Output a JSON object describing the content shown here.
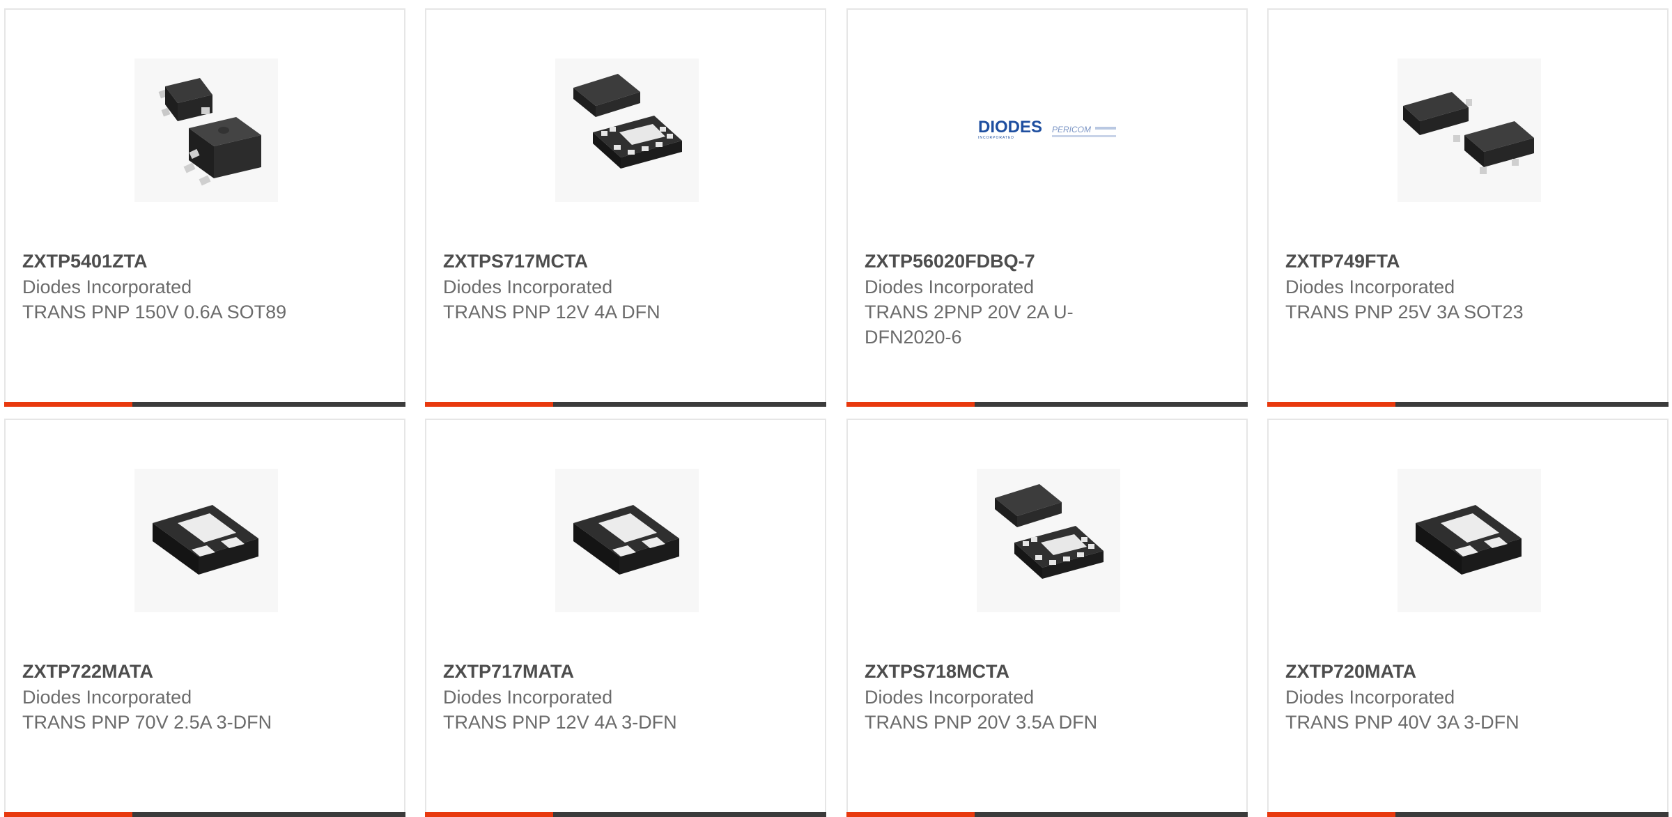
{
  "products": [
    {
      "part": "ZXTP5401ZTA",
      "manufacturer": "Diodes Incorporated",
      "description": "TRANS PNP 150V 0.6A SOT89",
      "image": "sot89-package-icon"
    },
    {
      "part": "ZXTPS717MCTA",
      "manufacturer": "Diodes Incorporated",
      "description": "TRANS PNP 12V 4A DFN",
      "image": "dfn8-package-icon"
    },
    {
      "part": "ZXTP56020FDBQ-7",
      "manufacturer": "Diodes Incorporated",
      "description": "TRANS 2PNP 20V 2A U-DFN2020-6",
      "image": "diodes-pericom-logo",
      "logo_text": "DIODES",
      "logo_sub": "INCORPORATED",
      "logo_text2": "PERICOM"
    },
    {
      "part": "ZXTP749FTA",
      "manufacturer": "Diodes Incorporated",
      "description": "TRANS PNP 25V 3A SOT23",
      "image": "sot23-package-icon"
    },
    {
      "part": "ZXTP722MATA",
      "manufacturer": "Diodes Incorporated",
      "description": "TRANS PNP 70V 2.5A 3-DFN",
      "image": "dfn3-package-icon"
    },
    {
      "part": "ZXTP717MATA",
      "manufacturer": "Diodes Incorporated",
      "description": "TRANS PNP 12V 4A 3-DFN",
      "image": "dfn3-package-icon"
    },
    {
      "part": "ZXTPS718MCTA",
      "manufacturer": "Diodes Incorporated",
      "description": "TRANS PNP 20V 3.5A DFN",
      "image": "dfn8-package-icon"
    },
    {
      "part": "ZXTP720MATA",
      "manufacturer": "Diodes Incorporated",
      "description": "TRANS PNP 40V 3A 3-DFN",
      "image": "dfn3-package-icon"
    }
  ],
  "colors": {
    "accent": "#e8390e",
    "bar": "#3b3b3b",
    "part_text": "#4d4d4d",
    "body_text": "#6b6b6b",
    "border": "#e6e6e6"
  }
}
